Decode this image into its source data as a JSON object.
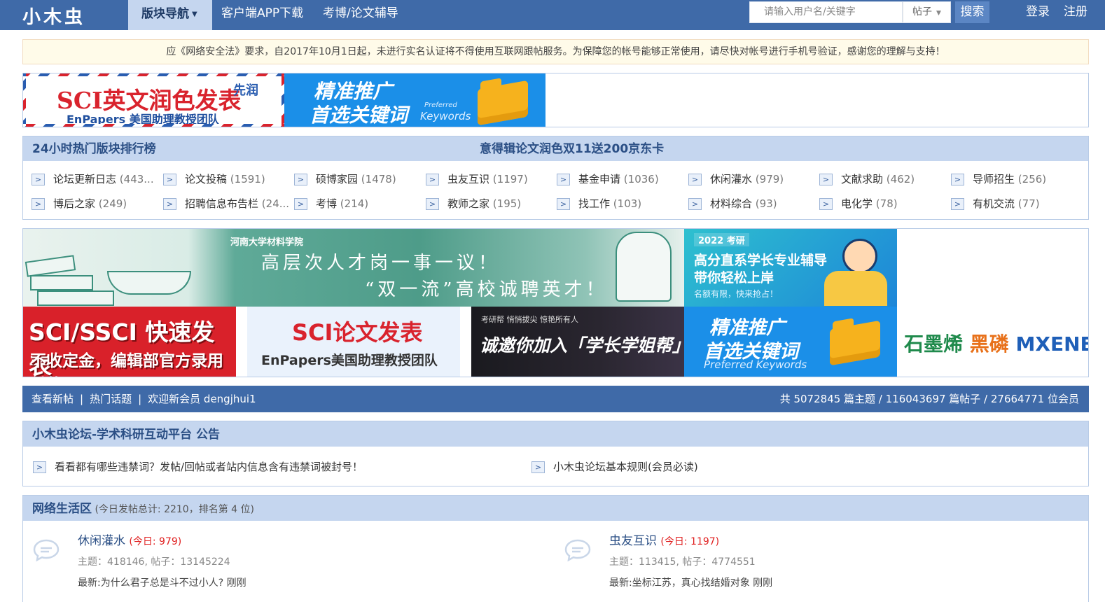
{
  "header": {
    "logo": "小木虫",
    "nav_active": "版块导航",
    "nav_links": [
      "客户端APP下载",
      "考博/论文辅导"
    ],
    "search_placeholder": "请输入用户名/关键字",
    "search_scope": "帖子",
    "search_button": "搜索",
    "login": "登录",
    "register": "注册",
    "accent_color": "#3f6aa8"
  },
  "notice": {
    "text": "应《网络安全法》要求，自2017年10月1日起，未进行实名认证将不得使用互联网跟帖服务。为保障您的帐号能够正常使用，请尽快对帐号进行手机号验证，感谢您的理解与支持！"
  },
  "ads_top": {
    "sci_title": "SCI英文润色发表",
    "sci_tag": "先润",
    "sci_sub": "EnPapers 美国助理教授团队",
    "kw_line1": "精准推广",
    "kw_line2": "首选关键词",
    "kw_small": "Preferred",
    "kw_en": "Keywords"
  },
  "hot": {
    "title": "24小时热门版块排行榜",
    "promo": "意得辑论文润色双11送200京东卡",
    "boards": [
      {
        "name": "论坛更新日志",
        "count": "(443..."
      },
      {
        "name": "论文投稿",
        "count": "(1591)"
      },
      {
        "name": "硕博家园",
        "count": "(1478)"
      },
      {
        "name": "虫友互识",
        "count": "(1197)"
      },
      {
        "name": "基金申请",
        "count": "(1036)"
      },
      {
        "name": "休闲灌水",
        "count": "(979)"
      },
      {
        "name": "文献求助",
        "count": "(462)"
      },
      {
        "name": "导师招生",
        "count": "(256)"
      },
      {
        "name": "博后之家",
        "count": "(249)"
      },
      {
        "name": "招聘信息布告栏",
        "count": "(24..."
      },
      {
        "name": "考博",
        "count": "(214)"
      },
      {
        "name": "教师之家",
        "count": "(195)"
      },
      {
        "name": "找工作",
        "count": "(103)"
      },
      {
        "name": "材料综合",
        "count": "(93)"
      },
      {
        "name": "电化学",
        "count": "(78)"
      },
      {
        "name": "有机交流",
        "count": "(77)"
      }
    ]
  },
  "ads_grid": {
    "hn_school": "河南大学材料学院",
    "hn_line1": "高层次人才岗一事一议！",
    "hn_line2": "“双一流”高校诚聘英才！",
    "y2022_tag": "2022 考研",
    "y2022_h1": "高分直系学长专业辅导",
    "y2022_h2": "带你轻松上岸",
    "y2022_s": "名额有限，快来抢占！",
    "ssci_a": "SCI/SSCI 快速发表",
    "ssci_b": "不收定金，编辑部官方录用付款",
    "sci2_a": "SCI论文发表",
    "sci2_b": "EnPapers美国助理教授团队",
    "xzb_s": "考研帮 悄悄拔尖 惊艳所有人",
    "xzb_a": "诚邀你加入「学长学姐帮」",
    "kw_line1": "精准推广",
    "kw_line2": "首选关键词",
    "kw_en": "Preferred  Keywords",
    "gra_1": "石墨烯",
    "gra_2": "黑磷",
    "gra_3": "MXENE"
  },
  "stats": {
    "new_posts": "查看新帖",
    "hot_topics": "热门话题",
    "welcome": "欢迎新会员 dengjhui1",
    "summary": "共 5072845 篇主题  /  116043697 篇帖子  /  27664771 位会员"
  },
  "announcement": {
    "title": "小木虫论坛-学术科研互动平台 公告",
    "items": [
      "看看都有哪些违禁词？发帖/回帖或者站内信息含有违禁词被封号！",
      "小木虫论坛基本规则(会员必读)"
    ]
  },
  "section": {
    "title": "网络生活区",
    "subtitle": "(今日发帖总计: 2210，排名第 4 位)",
    "forums": [
      {
        "name": "休闲灌水",
        "today": "(今日: 979)",
        "meta": "主题：418146, 帖子：13145224",
        "last": "最新:为什么君子总是斗不过小人?   刚刚"
      },
      {
        "name": "虫友互识",
        "today": "(今日: 1197)",
        "meta": "主题：113415, 帖子：4774551",
        "last": "最新:坐标江苏，真心找结婚对象  刚刚"
      }
    ]
  }
}
